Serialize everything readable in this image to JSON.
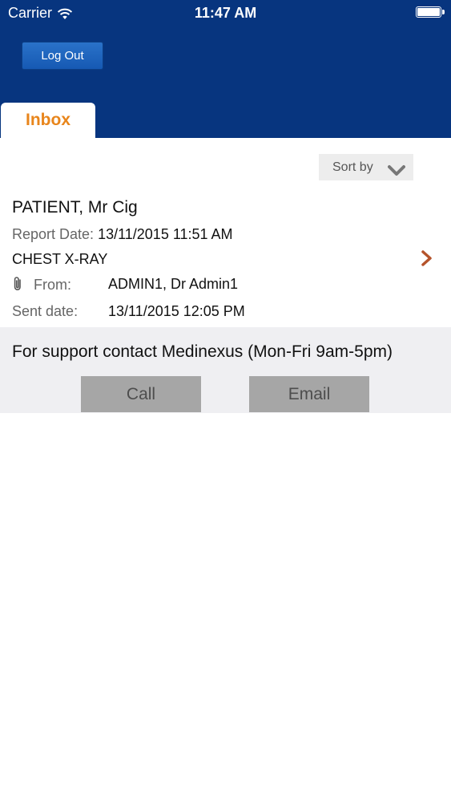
{
  "status_bar": {
    "carrier": "Carrier",
    "time": "11:47 AM",
    "icons": [
      "wifi-icon",
      "battery-icon"
    ]
  },
  "header": {
    "logout_label": "Log Out",
    "tab_label": "Inbox",
    "colors": {
      "background": "#07357f",
      "tab_text": "#e8851b",
      "button": "#1c63bd"
    }
  },
  "sort": {
    "label": "Sort by",
    "icon": "chevron-down-icon"
  },
  "message": {
    "patient": "PATIENT, Mr Cig",
    "report_date_label": "Report Date:",
    "report_date": "13/11/2015 11:51 AM",
    "exam": "CHEST X-RAY",
    "from_label": "From:",
    "from": "ADMIN1, Dr Admin1",
    "sent_label": "Sent date:",
    "sent_date": "13/11/2015 12:05 PM",
    "attachment_icon": "paperclip-icon",
    "chevron_icon": "chevron-right-icon",
    "chevron_color": "#b5532b"
  },
  "support": {
    "text": "For support contact Medinexus (Mon-Fri 9am-5pm)",
    "call_label": "Call",
    "email_label": "Email",
    "background": "#efeff2",
    "button_color": "#a6a6a6"
  }
}
